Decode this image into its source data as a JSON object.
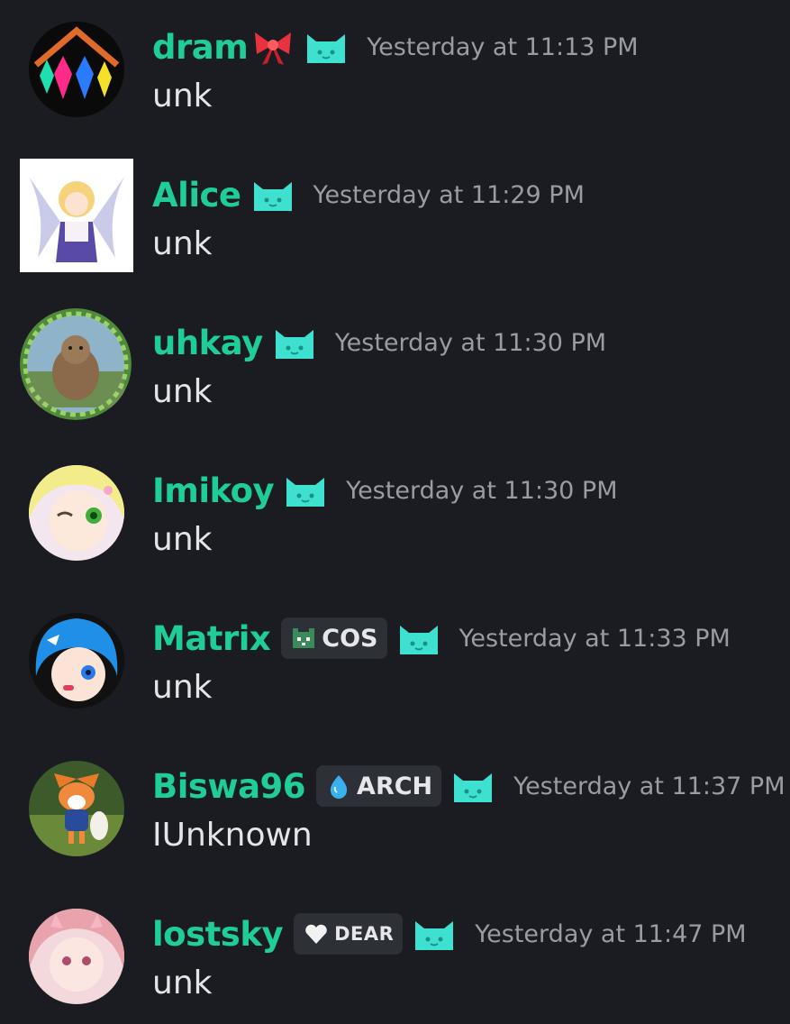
{
  "messages": [
    {
      "username": "dram",
      "name_emoji": "ribbon",
      "badge": null,
      "timestamp": "Yesterday at 11:13 PM",
      "content": "unk",
      "avatar_icon": "dram-avatar"
    },
    {
      "username": "Alice",
      "badge": null,
      "timestamp": "Yesterday at 11:29 PM",
      "content": "unk",
      "avatar_icon": "alice-avatar"
    },
    {
      "username": "uhkay",
      "badge": null,
      "timestamp": "Yesterday at 11:30 PM",
      "content": "unk",
      "avatar_icon": "uhkay-avatar"
    },
    {
      "username": "Imikoy",
      "badge": null,
      "timestamp": "Yesterday at 11:30 PM",
      "content": "unk",
      "avatar_icon": "imikoy-avatar"
    },
    {
      "username": "Matrix",
      "badge": {
        "label": "COS",
        "icon": "pixel-cat-icon"
      },
      "timestamp": "Yesterday at 11:33 PM",
      "content": "unk",
      "avatar_icon": "matrix-avatar"
    },
    {
      "username": "Biswa96",
      "badge": {
        "label": "ARCH",
        "icon": "droplet-icon"
      },
      "timestamp": "Yesterday at 11:37 PM",
      "content": "IUnknown",
      "avatar_icon": "fox-avatar"
    },
    {
      "username": "lostsky",
      "badge": {
        "label": "DEAR",
        "icon": "heart-icon"
      },
      "timestamp": "Yesterday at 11:47 PM",
      "content": "unk",
      "avatar_icon": "lostsky-avatar"
    }
  ],
  "colors": {
    "background": "#1b1c22",
    "username": "#1fcd9a",
    "timestamp": "#9a9ba3",
    "cat_badge": "#3ee0cf",
    "tag_bg": "#2e3038"
  },
  "cat_badge_icon": "cat-face-icon"
}
